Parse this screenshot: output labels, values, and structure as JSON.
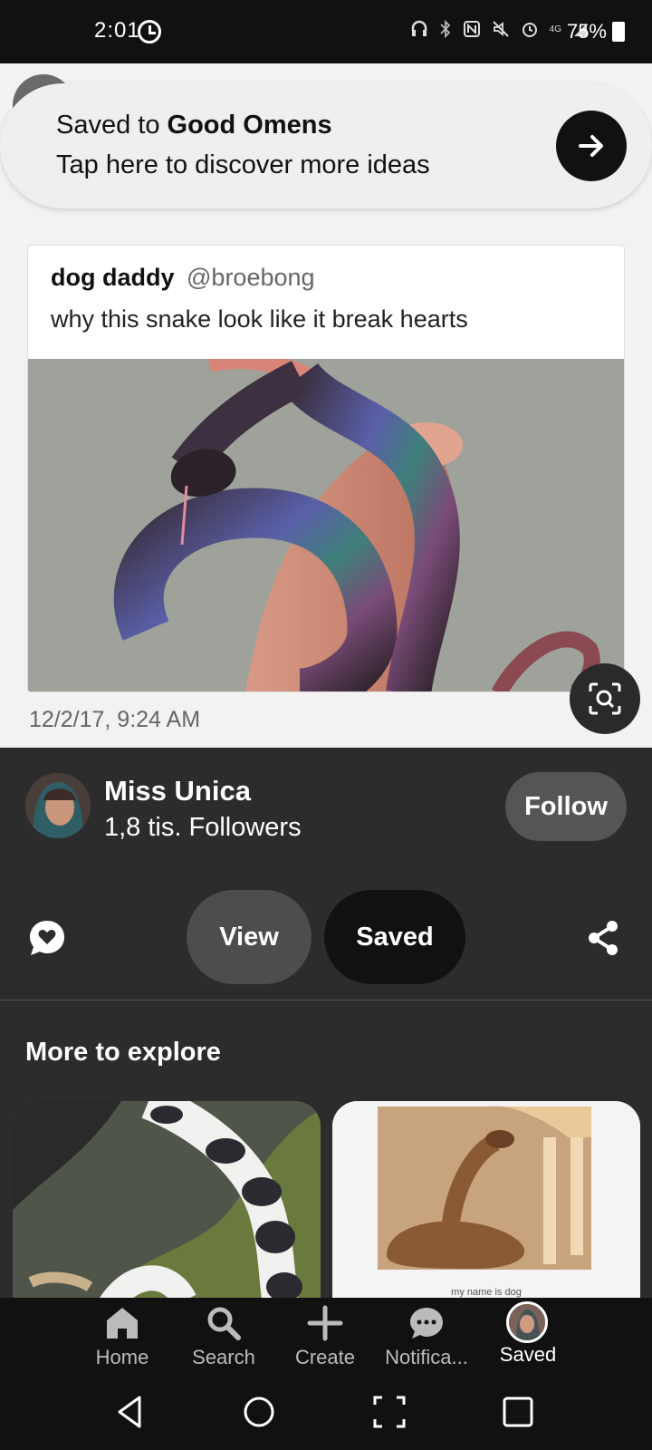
{
  "status_bar": {
    "time": "2:01",
    "network": "4G",
    "battery": "75%",
    "icons": [
      "alarm-clock-icon",
      "headphones-icon",
      "bluetooth-icon",
      "nfc-icon",
      "mute-icon",
      "alarm-icon",
      "signal-icon",
      "battery-icon"
    ]
  },
  "toast": {
    "saved_prefix": "Saved to ",
    "board_name": "Good Omens",
    "subtitle": "Tap here to discover more ideas"
  },
  "pin": {
    "tweet_name": "dog daddy",
    "tweet_handle": "@broebong",
    "tweet_text": "why this snake look like it break hearts",
    "tweet_date": "12/2/17, 9:24 AM"
  },
  "creator": {
    "name": "Miss Unica",
    "followers": "1,8 tis. Followers",
    "follow_label": "Follow"
  },
  "actions": {
    "view_label": "View",
    "saved_label": "Saved"
  },
  "explore": {
    "title": "More to explore",
    "item2_caption": "my name is dog"
  },
  "bottom_nav": {
    "home": "Home",
    "search": "Search",
    "create": "Create",
    "notifications": "Notifica...",
    "saved": "Saved"
  },
  "colors": {
    "dark_panel": "#2c2c2c",
    "accent_black": "#111111",
    "follow_bg": "#555555"
  }
}
